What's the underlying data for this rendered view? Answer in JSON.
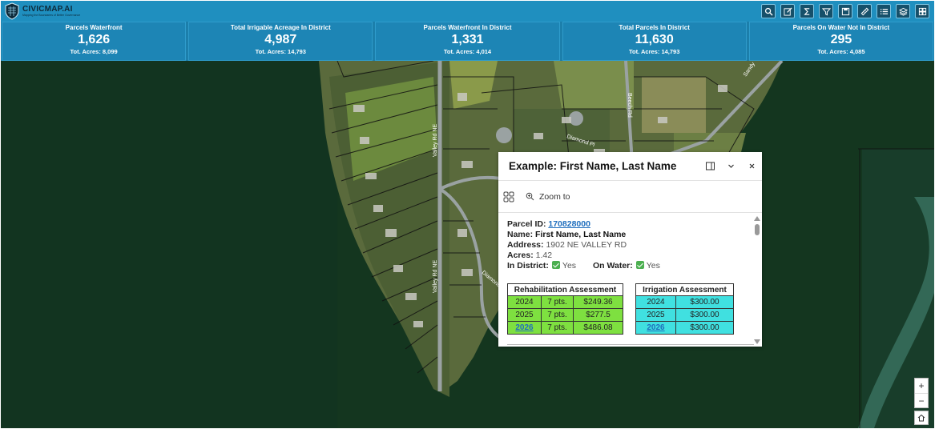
{
  "app": {
    "title": "CIVICMAP.AI",
    "tagline": "Mapping the Boundaries of Better Governance"
  },
  "toolbar": [
    {
      "name": "search-tool",
      "icon": "search-icon"
    },
    {
      "name": "edit-tool",
      "icon": "edit-icon"
    },
    {
      "name": "sum-tool",
      "icon": "sigma-icon"
    },
    {
      "name": "query-tool",
      "icon": "filter-icon"
    },
    {
      "name": "save-tool",
      "icon": "save-icon"
    },
    {
      "name": "measure-tool",
      "icon": "ruler-icon"
    },
    {
      "name": "list-tool",
      "icon": "list-icon"
    },
    {
      "name": "layers-tool",
      "icon": "layers-icon"
    },
    {
      "name": "basemap-tool",
      "icon": "grid-icon"
    }
  ],
  "stats": [
    {
      "label": "Parcels Waterfront",
      "value": "1,626",
      "sub": "Tot. Acres: 8,099"
    },
    {
      "label": "Total Irrigable Acreage In District",
      "value": "4,987",
      "sub": "Tot. Acres: 14,793"
    },
    {
      "label": "Parcels Waterfront In District",
      "value": "1,331",
      "sub": "Tot. Acres: 4,014"
    },
    {
      "label": "Total Parcels In District",
      "value": "11,630",
      "sub": "Tot. Acres: 14,793"
    },
    {
      "label": "Parcels On Water Not In District",
      "value": "295",
      "sub": "Tot. Acres: 4,085"
    }
  ],
  "map": {
    "street_labels": [
      "Valley Rd NE",
      "Valley Rd NE",
      "Diamond Pl",
      "Diamond",
      "Beech Rd",
      "Sandy"
    ]
  },
  "popup": {
    "title": "Example: First Name, Last Name",
    "zoom_label": "Zoom to",
    "parcel_id_label": "Parcel ID:",
    "parcel_id": "170828000",
    "name_label": "Name:",
    "name": "First Name, Last Name",
    "address_label": "Address:",
    "address": "1902 NE VALLEY RD",
    "acres_label": "Acres:",
    "acres": "1.42",
    "in_district_label": "In District:",
    "in_district": "Yes",
    "on_water_label": "On Water:",
    "on_water": "Yes",
    "rehab": {
      "title": "Rehabilitation Assessment",
      "rows": [
        {
          "year": "2024",
          "pts": "7 pts.",
          "amount": "$249.36",
          "link": false
        },
        {
          "year": "2025",
          "pts": "7 pts.",
          "amount": "$277.5",
          "link": false
        },
        {
          "year": "2026",
          "pts": "7 pts.",
          "amount": "$486.08",
          "link": true
        }
      ]
    },
    "irrigation": {
      "title": "Irrigation Assessment",
      "rows": [
        {
          "year": "2024",
          "amount": "$300.00",
          "link": false
        },
        {
          "year": "2025",
          "amount": "$300.00",
          "link": false
        },
        {
          "year": "2026",
          "amount": "$300.00",
          "link": true
        }
      ]
    }
  },
  "zoom": {
    "in": "+",
    "out": "−"
  }
}
